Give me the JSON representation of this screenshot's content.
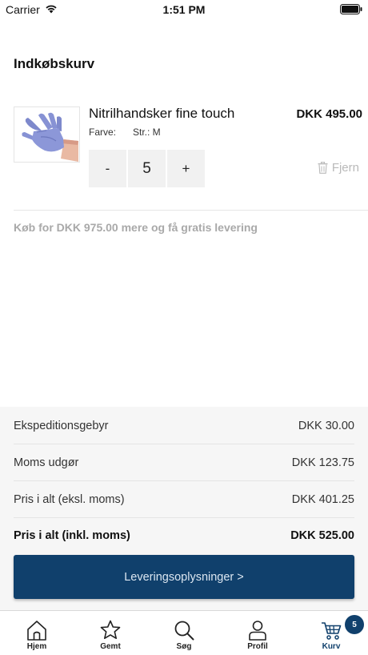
{
  "status_bar": {
    "carrier": "Carrier",
    "time": "1:51 PM",
    "icons": [
      "wifi-icon",
      "battery-icon"
    ]
  },
  "header": {
    "title": "Indkøbskurv"
  },
  "cart": {
    "items": [
      {
        "image": "blue-nitrile-glove",
        "name": "Nitrilhandsker fine touch",
        "price": "DKK 495.00",
        "color_label": "Farve:",
        "size_label": "Str.: M",
        "quantity": "5",
        "decrement_label": "-",
        "increment_label": "+",
        "remove_label": "Fjern"
      }
    ],
    "free_shipping_message": "Køb for DKK 975.00 mere og få gratis levering"
  },
  "summary": {
    "rows": [
      {
        "label": "Ekspeditionsgebyr",
        "value": "DKK 30.00"
      },
      {
        "label": "Moms udgør",
        "value": "DKK 123.75"
      },
      {
        "label": "Pris i alt (eksl. moms)",
        "value": "DKK 401.25"
      },
      {
        "label": "Pris i alt (inkl. moms)",
        "value": "DKK 525.00"
      }
    ]
  },
  "checkout": {
    "button_label": "Leveringsoplysninger >"
  },
  "tab_bar": {
    "items": [
      {
        "label": "Hjem",
        "icon": "home-icon",
        "active": false
      },
      {
        "label": "Gemt",
        "icon": "star-icon",
        "active": false
      },
      {
        "label": "Søg",
        "icon": "search-icon",
        "active": false
      },
      {
        "label": "Profil",
        "icon": "profile-icon",
        "active": false
      },
      {
        "label": "Kurv",
        "icon": "cart-icon",
        "active": true,
        "badge": "5"
      }
    ]
  },
  "colors": {
    "primary": "#10406c",
    "panel_background": "#f6f6f6",
    "muted_text": "#a9a9a9"
  }
}
